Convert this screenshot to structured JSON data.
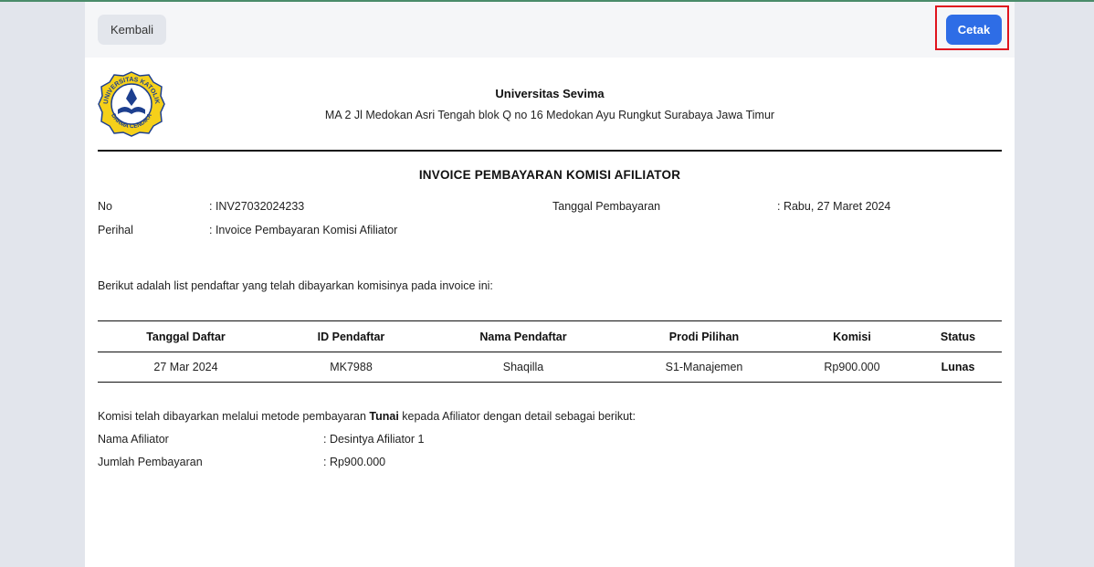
{
  "toolbar": {
    "back_label": "Kembali",
    "print_label": "Cetak"
  },
  "header": {
    "university_name": "Universitas Sevima",
    "address": "MA 2 Jl Medokan Asri Tengah blok Q no 16 Medokan Ayu Rungkut Surabaya Jawa Timur",
    "logo_text_top": "UNIVERSITAS KATOLIK",
    "logo_text_bottom": "DARMA CENDIKA"
  },
  "invoice": {
    "title": "INVOICE PEMBAYARAN KOMISI AFILIATOR",
    "no_label": "No",
    "no_value": ": INV27032024233",
    "subject_label": "Perihal",
    "subject_value": ": Invoice Pembayaran Komisi Afiliator",
    "date_label": "Tanggal Pembayaran",
    "date_value": ": Rabu, 27 Maret 2024",
    "intro": "Berikut adalah list pendaftar yang telah dibayarkan komisinya pada invoice ini:"
  },
  "table": {
    "headers": [
      "Tanggal Daftar",
      "ID Pendaftar",
      "Nama Pendaftar",
      "Prodi Pilihan",
      "Komisi",
      "Status"
    ],
    "rows": [
      [
        "27 Mar 2024",
        "MK7988",
        "Shaqilla",
        "S1-Manajemen",
        "Rp900.000",
        "Lunas"
      ]
    ]
  },
  "payment": {
    "text_before": "Komisi telah dibayarkan melalui metode pembayaran ",
    "method": "Tunai",
    "text_after": " kepada Afiliator dengan detail sebagai berikut:",
    "affiliate_label": "Nama Afiliator",
    "affiliate_value": ": Desintya Afiliator 1",
    "amount_label": "Jumlah Pembayaran",
    "amount_value": ": Rp900.000"
  },
  "colors": {
    "primary": "#2e6de6",
    "highlight": "#e0141e",
    "logo_yellow": "#f5d01a",
    "logo_blue": "#1d3f8f"
  }
}
